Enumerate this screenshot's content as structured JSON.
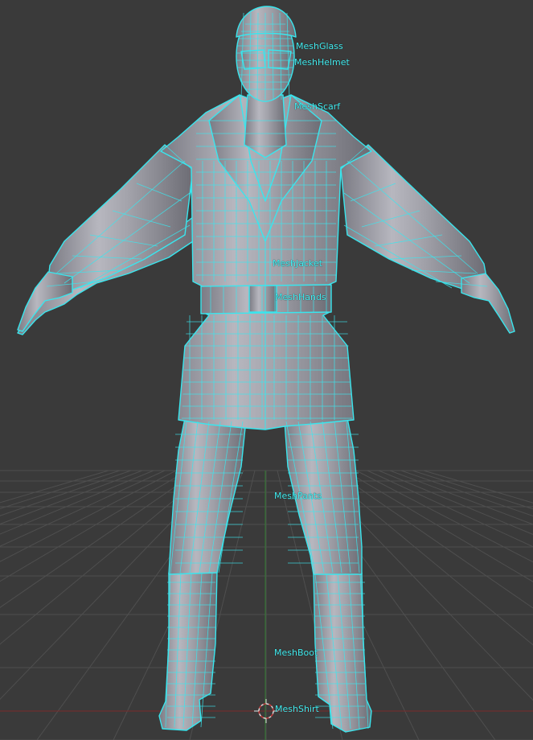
{
  "viewport": {
    "background": "#3a3a3a",
    "grid_color": "#4f4f4f",
    "x_axis_color": "#7a2a2a",
    "y_axis_color": "#2f7a2f",
    "mesh_fill": "#9a9aa2",
    "wire_color": "#39e6ee",
    "label_color": "#44eef2",
    "cursor_icon": "3d-cursor-crosshair"
  },
  "labels": {
    "glass": "MeshGlass",
    "helmet": "MeshHelmet",
    "scarf": "MeshScarf",
    "jacket": "MeshJacket",
    "hands": "MeshHands",
    "pants": "MeshPants",
    "boot": "MeshBoot",
    "shirt": "MeshShirt"
  }
}
